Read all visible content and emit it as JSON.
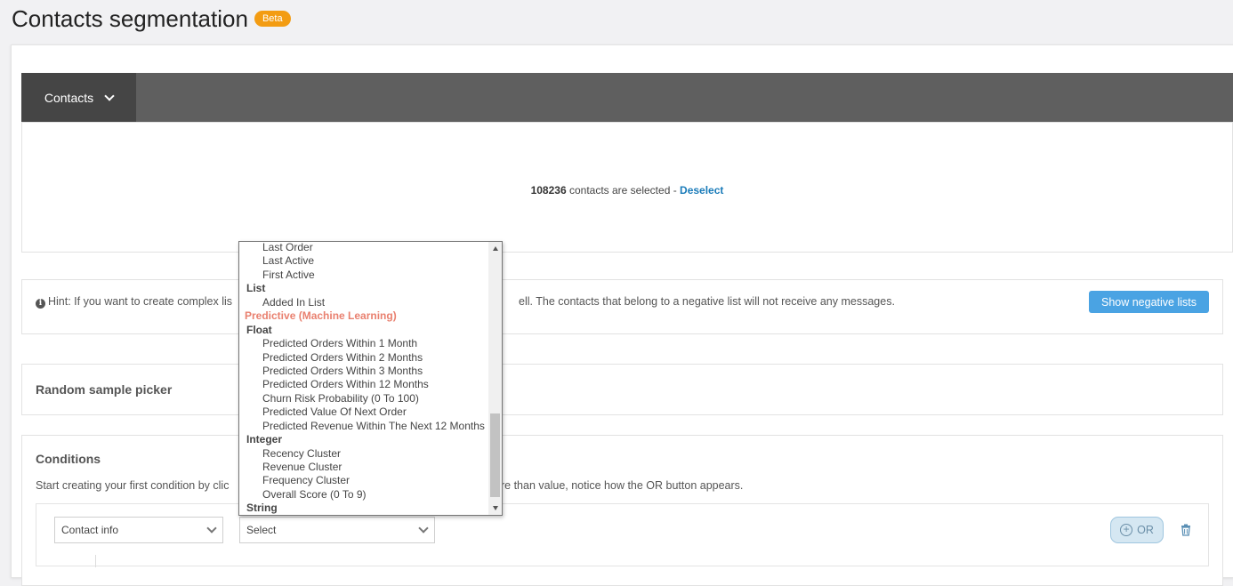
{
  "header": {
    "title": "Contacts segmentation",
    "badge": "Beta"
  },
  "tabs": {
    "contacts_label": "Contacts"
  },
  "selection": {
    "count": "108236",
    "text": "contacts are selected - ",
    "deselect_label": "Deselect"
  },
  "hint": {
    "text_left": "Hint: If you want to create complex lis",
    "text_right": "ell. The contacts that belong to a negative list will not receive any messages.",
    "button_label": "Show negative lists"
  },
  "random_sample": {
    "title": "Random sample picker"
  },
  "conditions": {
    "title": "Conditions",
    "desc_left": "Start creating your first condition by clic",
    "desc_right": "re than value, notice how the OR button appears.",
    "field_select": "Contact info",
    "operator_select": "Select",
    "or_label": "OR"
  },
  "dropdown": {
    "items": [
      {
        "label": "Last Order",
        "type": "option"
      },
      {
        "label": "Last Active",
        "type": "option"
      },
      {
        "label": "First Active",
        "type": "option"
      },
      {
        "label": "List",
        "type": "group"
      },
      {
        "label": "Added In List",
        "type": "option"
      },
      {
        "label": "Predictive (Machine Learning)",
        "type": "group-ml"
      },
      {
        "label": "Float",
        "type": "group"
      },
      {
        "label": "Predicted Orders Within 1 Month",
        "type": "option"
      },
      {
        "label": "Predicted Orders Within 2 Months",
        "type": "option"
      },
      {
        "label": "Predicted Orders Within 3 Months",
        "type": "option"
      },
      {
        "label": "Predicted Orders Within 12 Months",
        "type": "option"
      },
      {
        "label": "Churn Risk Probability (0 To 100)",
        "type": "option"
      },
      {
        "label": "Predicted Value Of Next Order",
        "type": "option"
      },
      {
        "label": "Predicted Revenue Within The Next 12 Months",
        "type": "option"
      },
      {
        "label": "Integer",
        "type": "group"
      },
      {
        "label": "Recency Cluster",
        "type": "option"
      },
      {
        "label": "Revenue Cluster",
        "type": "option"
      },
      {
        "label": "Frequency Cluster",
        "type": "option"
      },
      {
        "label": "Overall Score (0 To 9)",
        "type": "option"
      },
      {
        "label": "String",
        "type": "group"
      }
    ]
  },
  "colors": {
    "accent": "#4aa3e3",
    "badge": "#f39c12",
    "ml_group": "#e9806f",
    "dark_bar": "#5f5f5f"
  }
}
